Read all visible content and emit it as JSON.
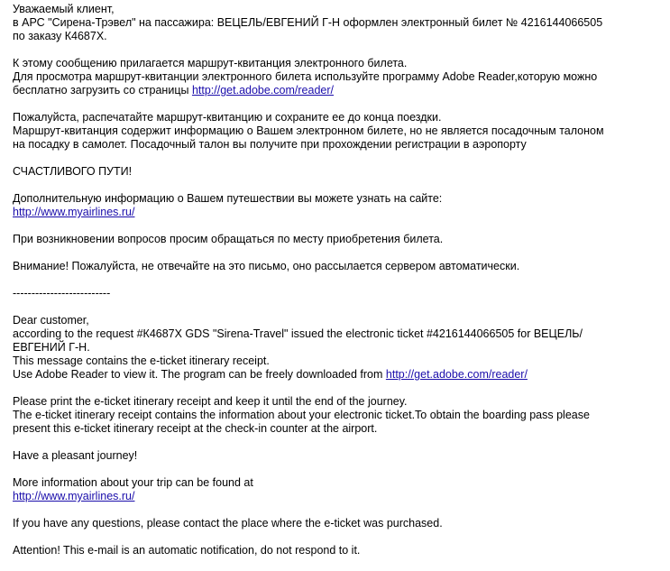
{
  "ru": {
    "greeting": "Уважаемый клиент,",
    "issued_line": "в АРС \"Сирена-Трэвел\" на пассажира: ВЕЦЕЛЬ/ЕВГЕНИЙ Г-Н оформлен электронный билет № 4216144066505",
    "order_line": "по заказу К4687Х.",
    "attach_line": "К этому сообщению прилагается маршрут-квитанция электронного билета.",
    "view_line": "Для просмотра маршрут-квитанции электронного билета используйте программу Adobe Reader,которую можно",
    "download_prefix": "бесплатно загрузить со страницы ",
    "download_link": "http://get.adobe.com/reader/",
    "print_line": "Пожалуйста, распечатайте маршрут-квитанцию и сохраните ее до конца поездки.",
    "receipt_line1": "Маршрут-квитанция содержит информацию о Вашем электронном билете, но не является посадочным талоном",
    "receipt_line2": "на посадку в самолет. Посадочный талон вы получите при прохождении регистрации в аэропорту",
    "happy": "СЧАСТЛИВОГО ПУТИ!",
    "more_info": "Дополнительную информацию о Вашем путешествии вы можете узнать на сайте:",
    "site_link": "http://www.myairlines.ru/",
    "questions": "При возникновении вопросов просим обращаться по месту приобретения билета.",
    "attention": "Внимание! Пожалуйста, не отвечайте на это письмо, оно рассылается сервером автоматически."
  },
  "separator": "--------------------------",
  "en": {
    "greeting": "Dear customer,",
    "issued_line1": "according to the request #К4687Х GDS \"Sirena-Travel\" issued the electronic ticket #4216144066505 for ВЕЦЕЛЬ/",
    "issued_line2": "ЕВГЕНИЙ Г-Н.",
    "contains": "This message contains the e-ticket itinerary receipt.",
    "use_prefix": "Use Adobe Reader to view it. The program can be freely downloaded from ",
    "download_link": "http://get.adobe.com/reader/",
    "print_line": "Please print the e-ticket itinerary receipt and keep it until the end of the journey.",
    "receipt_line1": "The e-ticket itinerary receipt contains the information about your electronic ticket.To obtain the boarding pass please",
    "receipt_line2": "present this e-ticket itinerary receipt at the check-in counter at the airport.",
    "pleasant": "Have a pleasant journey!",
    "more_info": "More information about your trip can be found at",
    "site_link": "http://www.myairlines.ru/",
    "questions": "If you have any questions, please contact the place where the e-ticket was purchased.",
    "attention": "Attention! This e-mail is an automatic notification, do not respond to it."
  },
  "colors": {
    "text": "#000000",
    "link": "#1a0dab",
    "background": "#ffffff"
  }
}
